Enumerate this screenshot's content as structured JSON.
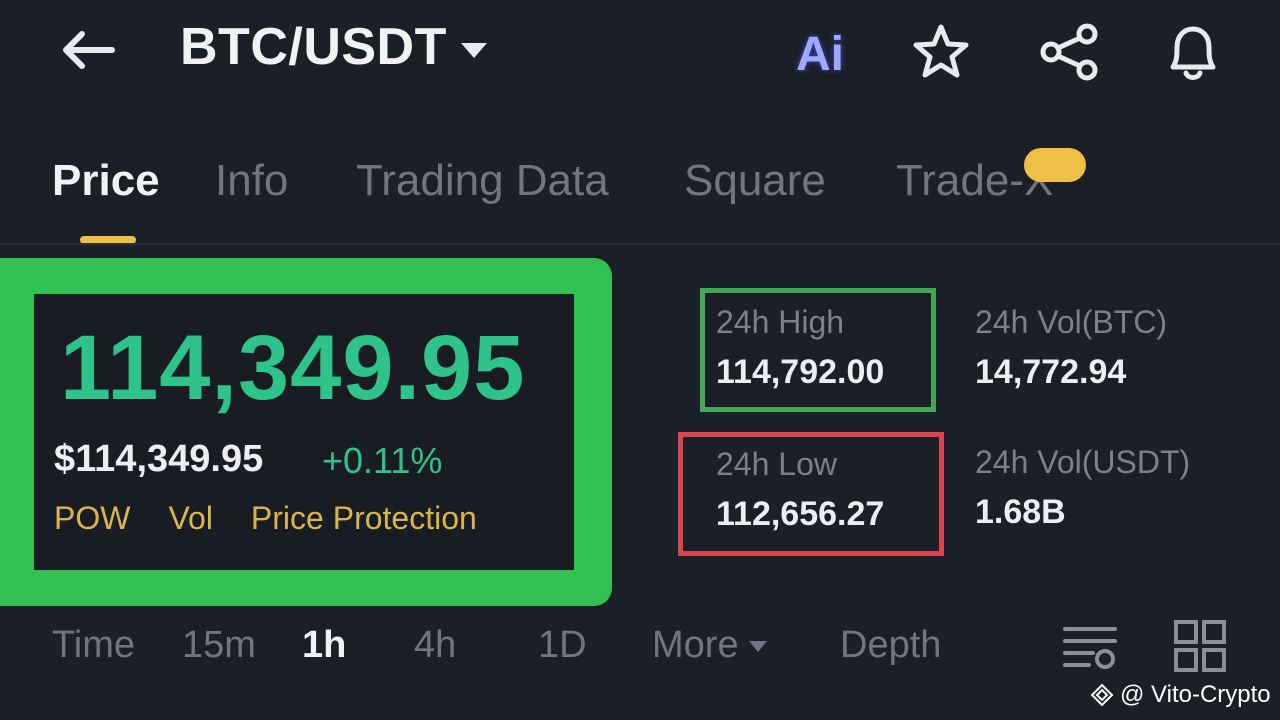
{
  "header": {
    "pair": "BTC/USDT",
    "ai_label": "Ai",
    "icons": [
      "back-arrow-icon",
      "star-icon",
      "share-icon",
      "bell-icon"
    ]
  },
  "tabs": [
    {
      "label": "Price",
      "active": true
    },
    {
      "label": "Info"
    },
    {
      "label": "Trading Data"
    },
    {
      "label": "Square"
    },
    {
      "label": "Trade-X"
    }
  ],
  "price": {
    "last": "114,349.95",
    "usd": "$114,349.95",
    "change": "+0.11%",
    "tags": [
      "POW",
      "Vol",
      "Price Protection"
    ]
  },
  "stats": {
    "high": {
      "label": "24h High",
      "value": "114,792.00"
    },
    "low": {
      "label": "24h Low",
      "value": "112,656.27"
    },
    "vol_btc": {
      "label": "24h Vol(BTC)",
      "value": "14,772.94"
    },
    "vol_usdt": {
      "label": "24h Vol(USDT)",
      "value": "1.68B"
    }
  },
  "intervals": [
    {
      "label": "Time"
    },
    {
      "label": "15m"
    },
    {
      "label": "1h",
      "active": true
    },
    {
      "label": "4h"
    },
    {
      "label": "1D"
    },
    {
      "label": "More"
    },
    {
      "label": "Depth"
    }
  ],
  "watermark": "@ Vito-Crypto",
  "colors": {
    "background": "#1b1f27",
    "up_green": "#2ec38a",
    "accent_yellow": "#f0c046",
    "highlight_green": "#33c052",
    "highlight_red": "#d8454e"
  }
}
